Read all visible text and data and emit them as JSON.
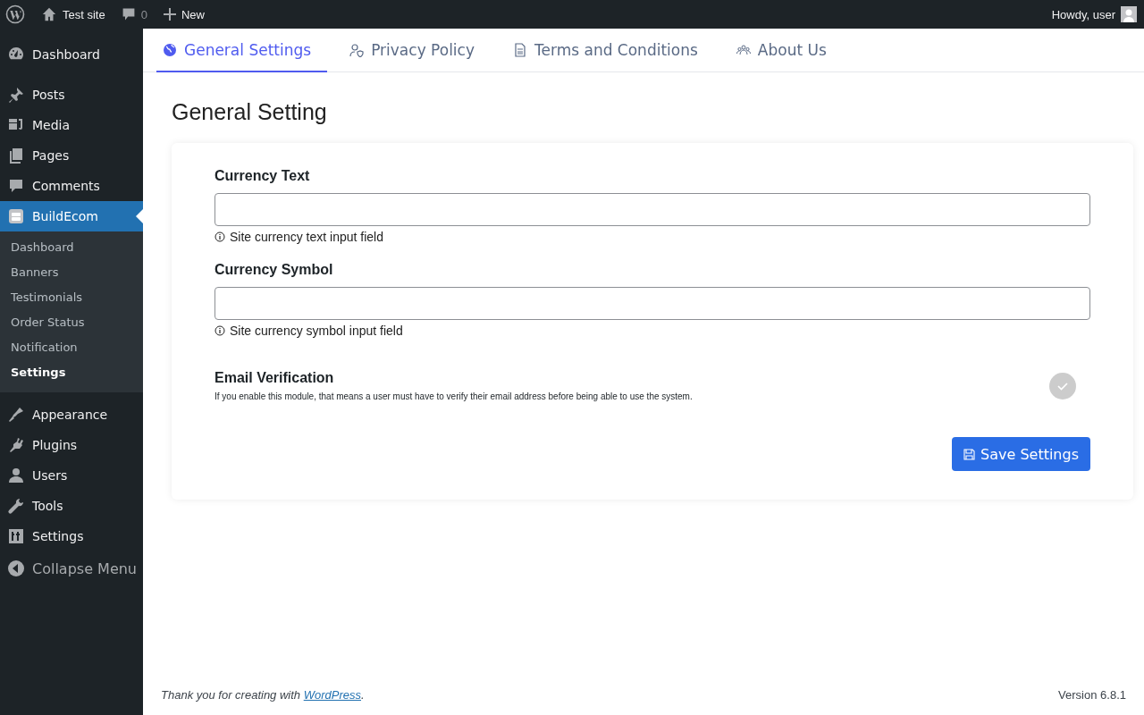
{
  "admin_bar": {
    "site": "Test site",
    "comments": "0",
    "new": "New",
    "greeting": "Howdy, user"
  },
  "sidebar": {
    "items": [
      {
        "label": "Dashboard",
        "selected": false
      },
      {
        "label": "Posts",
        "selected": false
      },
      {
        "label": "Media",
        "selected": false
      },
      {
        "label": "Pages",
        "selected": false
      },
      {
        "label": "Comments",
        "selected": false
      },
      {
        "label": "BuildEcom",
        "selected": true,
        "children": [
          {
            "label": "Dashboard",
            "selected": false
          },
          {
            "label": "Banners",
            "selected": false
          },
          {
            "label": "Testimonials",
            "selected": false
          },
          {
            "label": "Order Status",
            "selected": false
          },
          {
            "label": "Notification",
            "selected": false
          },
          {
            "label": "Settings",
            "selected": true
          }
        ]
      },
      {
        "label": "Appearance",
        "selected": false
      },
      {
        "label": "Plugins",
        "selected": false
      },
      {
        "label": "Users",
        "selected": false
      },
      {
        "label": "Tools",
        "selected": false
      },
      {
        "label": "Settings",
        "selected": false
      }
    ],
    "collapse": "Collapse Menu"
  },
  "tabs": [
    {
      "label": "General Settings",
      "selected": true
    },
    {
      "label": "Privacy Policy",
      "selected": false
    },
    {
      "label": "Terms and Conditions",
      "selected": false
    },
    {
      "label": "About Us",
      "selected": false
    }
  ],
  "page_title": "General Setting",
  "fields": [
    {
      "label": "Currency Text",
      "hint": "Site currency text input field"
    },
    {
      "label": "Currency Symbol",
      "hint": "Site currency symbol input field"
    }
  ],
  "email_verification": {
    "title": "Email Verification",
    "description": "If you enable this module, that means a user must have to verify their email address before being able to use the system.",
    "on": false
  },
  "save_button": "Save Settings",
  "footer": {
    "thanks": "Thank you for creating with",
    "link": "WordPress",
    "period": ".",
    "version": "Version 6.8.1"
  }
}
